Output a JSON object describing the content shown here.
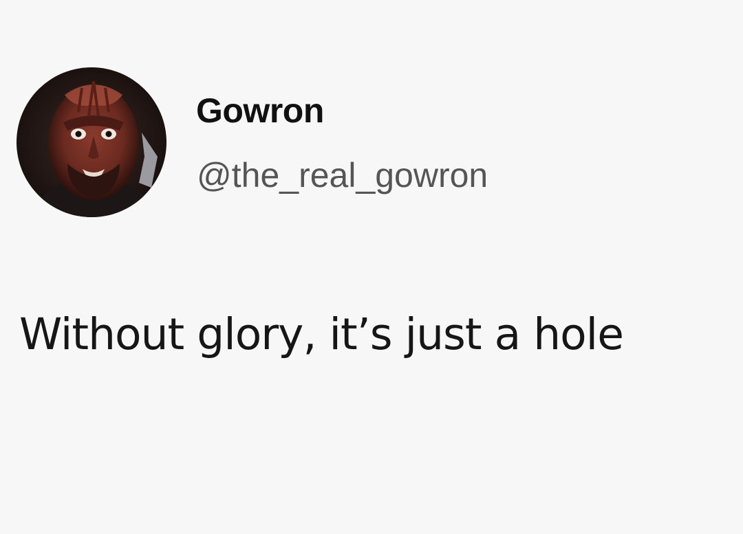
{
  "post": {
    "author": {
      "display_name": "Gowron",
      "handle": "@the_real_gowron",
      "avatar_icon": "klingon-portrait"
    },
    "text": "Without glory, it’s just a hole"
  },
  "colors": {
    "background": "#f7f7f7",
    "name_text": "#111111",
    "handle_text": "#555555",
    "body_text": "#161616"
  }
}
